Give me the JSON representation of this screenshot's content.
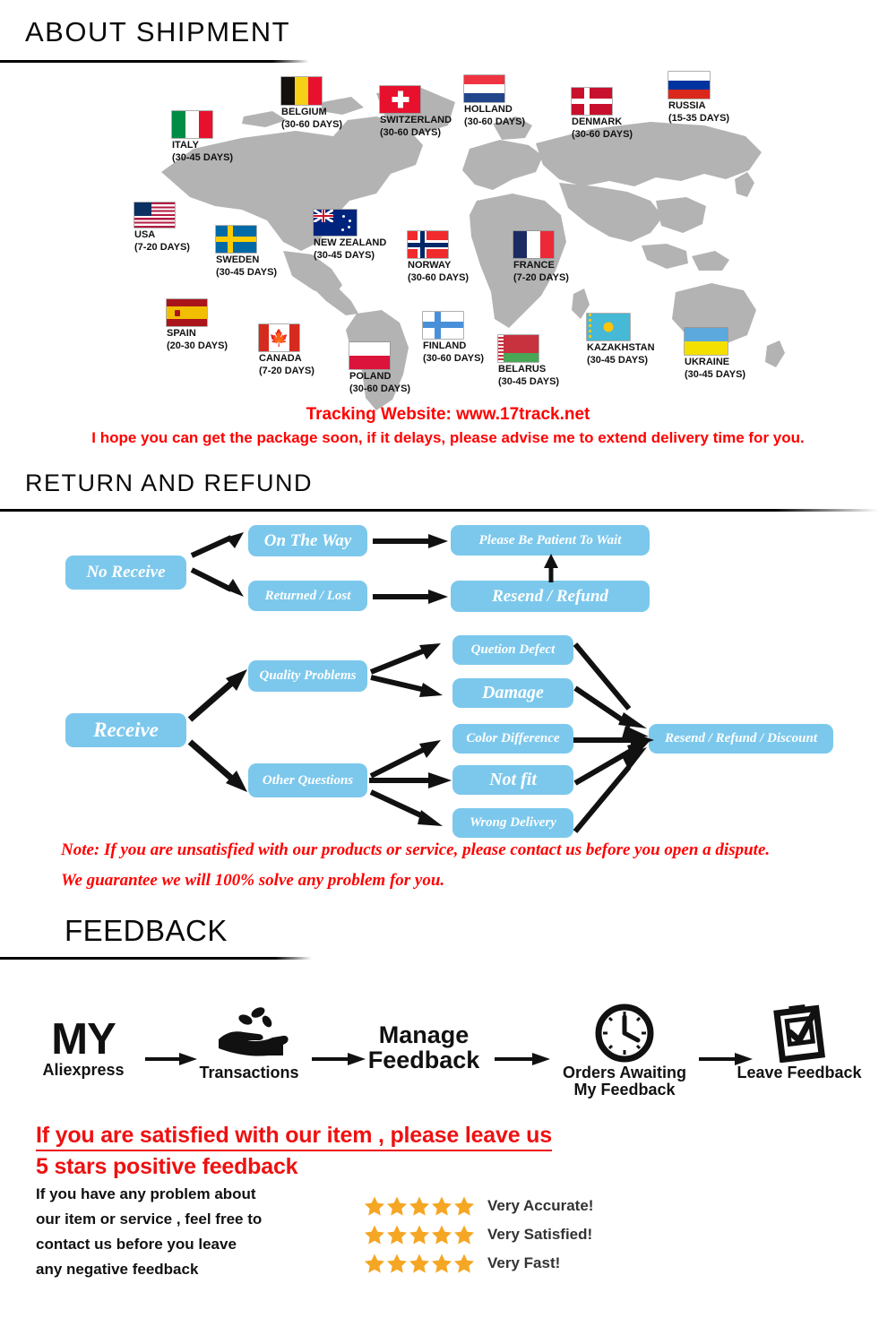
{
  "sections": {
    "shipment_title": "ABOUT  SHIPMENT",
    "return_title": "RETURN AND REFUND",
    "feedback_title": "FEEDBACK"
  },
  "shipment": {
    "countries": [
      {
        "name": "ITALY",
        "days": "(30-45 DAYS)",
        "flag": "italy-flag"
      },
      {
        "name": "BELGIUM",
        "days": "(30-60 DAYS)",
        "flag": "belgium-flag"
      },
      {
        "name": "SWITZERLAND",
        "days": "(30-60 DAYS)",
        "flag": "switzerland-flag"
      },
      {
        "name": "HOLLAND",
        "days": "(30-60 DAYS)",
        "flag": "holland-flag"
      },
      {
        "name": "DENMARK",
        "days": "(30-60 DAYS)",
        "flag": "denmark-flag"
      },
      {
        "name": "RUSSIA",
        "days": "(15-35 DAYS)",
        "flag": "russia-flag"
      },
      {
        "name": "USA",
        "days": "(7-20 DAYS)",
        "flag": "usa-flag"
      },
      {
        "name": "SWEDEN",
        "days": "(30-45 DAYS)",
        "flag": "sweden-flag"
      },
      {
        "name": "NEW ZEALAND",
        "days": "(30-45 DAYS)",
        "flag": "new-zealand-flag"
      },
      {
        "name": "NORWAY",
        "days": "(30-60 DAYS)",
        "flag": "norway-flag"
      },
      {
        "name": "FRANCE",
        "days": "(7-20 DAYS)",
        "flag": "france-flag"
      },
      {
        "name": "SPAIN",
        "days": "(20-30 DAYS)",
        "flag": "spain-flag"
      },
      {
        "name": "CANADA",
        "days": "(7-20 DAYS)",
        "flag": "canada-flag"
      },
      {
        "name": "POLAND",
        "days": "(30-60 DAYS)",
        "flag": "poland-flag"
      },
      {
        "name": "FINLAND",
        "days": "(30-60 DAYS)",
        "flag": "finland-flag"
      },
      {
        "name": "BELARUS",
        "days": "(30-45 DAYS)",
        "flag": "belarus-flag"
      },
      {
        "name": "KAZAKHSTAN",
        "days": "(30-45 DAYS)",
        "flag": "kazakhstan-flag"
      },
      {
        "name": "UKRAINE",
        "days": "(30-45 DAYS)",
        "flag": "ukraine-flag"
      }
    ],
    "tracking_line": "Tracking Website: www.17track.net",
    "hope_line": "I hope you can get the package soon, if it delays, please advise me to extend delivery time for you."
  },
  "flow": {
    "nodes": {
      "no_receive": "No Receive",
      "on_the_way": "On The Way",
      "returned_lost": "Returned / Lost",
      "please_wait": "Please Be Patient To Wait",
      "resend_refund": "Resend / Refund",
      "receive": "Receive",
      "quality_problems": "Quality Problems",
      "other_questions": "Other Questions",
      "quetion_defect": "Quetion Defect",
      "damage": "Damage",
      "color_difference": "Color Difference",
      "not_fit": "Not fit",
      "wrong_delivery": "Wrong Delivery",
      "resend_refund_discount": "Resend / Refund / Discount"
    },
    "note_line1": "Note: If you are unsatisfied with our products or service, please contact us before you open a dispute.",
    "note_line2": "We guarantee we will 100% solve any problem for you."
  },
  "feedback": {
    "steps": [
      {
        "label_top": "MY",
        "label_bottom": "Aliexpress",
        "icon": "my-aliexpress-text"
      },
      {
        "label_top": "",
        "label_bottom": "Transactions",
        "icon": "hand-coins-icon"
      },
      {
        "label_top": "Manage",
        "label_bottom": "Feedback",
        "icon": "manage-feedback-text"
      },
      {
        "label_top": "Orders Awaiting",
        "label_bottom": "My Feedback",
        "icon": "clock-icon"
      },
      {
        "label_top": "",
        "label_bottom": "Leave Feedback",
        "icon": "clipboard-check-icon"
      }
    ],
    "red_line1": "If you are satisfied with our item , please leave us",
    "red_line2": "5 stars positive feedback",
    "paragraph": [
      "If you have any problem about",
      "our item or service , feel free to",
      "contact us before you  leave",
      "any negative feedback"
    ],
    "ratings": [
      {
        "stars": 5,
        "text": "Very Accurate!"
      },
      {
        "stars": 5,
        "text": "Very Satisfied!"
      },
      {
        "stars": 5,
        "text": "Very Fast!"
      }
    ]
  },
  "colors": {
    "node_blue": "#7cc8ec",
    "red": "#ff0000",
    "star_orange": "#f5a623",
    "map_gray": "#b3b3b3"
  }
}
